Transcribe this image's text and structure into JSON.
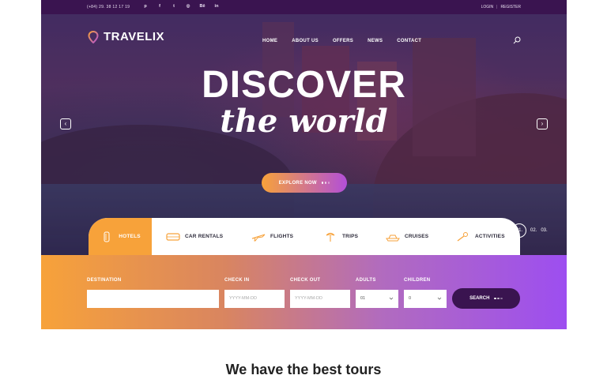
{
  "topbar": {
    "phone": "(+84) 29. 38 12 17 19",
    "socials": [
      "pinterest-icon",
      "facebook-icon",
      "twitter-icon",
      "dribbble-icon",
      "behance-icon",
      "linkedin-icon"
    ],
    "login": "LOGIN",
    "register": "REGISTER",
    "separator": "|"
  },
  "header": {
    "logo": "TRAVELIX",
    "nav": [
      "HOME",
      "ABOUT US",
      "OFFERS",
      "NEWS",
      "CONTACT"
    ]
  },
  "hero": {
    "title": "DISCOVER",
    "subtitle": "the world",
    "cta": "EXPLORE NOW",
    "prev": "‹",
    "next": "›",
    "slides": [
      "01.",
      "02.",
      "03."
    ]
  },
  "tabs": [
    {
      "label": "HOTELS",
      "icon": "suitcase-icon",
      "active": true
    },
    {
      "label": "CAR RENTALS",
      "icon": "bus-icon"
    },
    {
      "label": "FLIGHTS",
      "icon": "airplane-icon"
    },
    {
      "label": "TRIPS",
      "icon": "trips-icon"
    },
    {
      "label": "CRUISES",
      "icon": "ship-icon"
    },
    {
      "label": "ACTIVITIES",
      "icon": "activities-icon"
    }
  ],
  "search": {
    "destination_label": "DESTINATION",
    "destination_value": "",
    "checkin_label": "CHECK IN",
    "checkin_placeholder": "YYYY-MM-DD",
    "checkout_label": "CHECK OUT",
    "checkout_placeholder": "YYYY-MM-DD",
    "adults_label": "ADULTS",
    "adults_value": "01",
    "children_label": "CHILDREN",
    "children_value": "0",
    "button": "SEARCH"
  },
  "section_title": "We have the best tours",
  "colors": {
    "brand_dark": "#3a1450",
    "accent_orange": "#f7a23a",
    "accent_purple": "#9d4ef0"
  }
}
